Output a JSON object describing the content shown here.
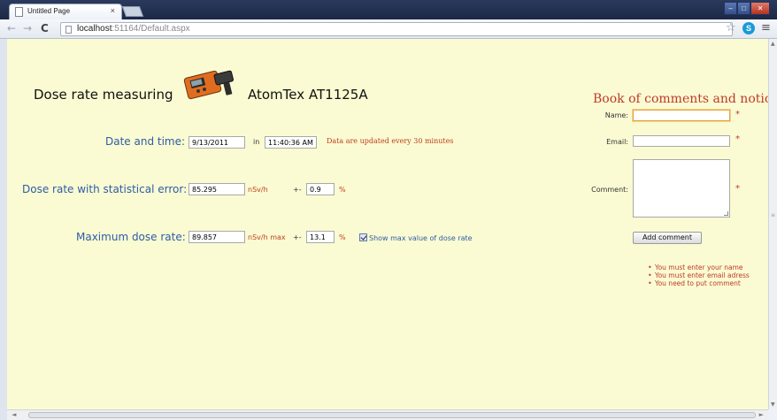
{
  "browser": {
    "tab_title": "Untitled Page",
    "tab_close": "×",
    "url_host": "localhost",
    "url_rest": ":51164/Default.aspx"
  },
  "page": {
    "title_left": "Dose rate measuring",
    "title_right": "AtomTex AT1125A",
    "datetime": {
      "label": "Date and time:",
      "date": "9/13/2011",
      "in_text": "in",
      "time": "11:40:36 AM",
      "note": "Data are updated every 30 minutes"
    },
    "dose_rate": {
      "label": "Dose rate with statistical error:",
      "value": "85.295",
      "unit": "nSv/h",
      "pm": "+-",
      "error": "0.9",
      "error_unit": "%"
    },
    "max_dose": {
      "label": "Maximum dose rate:",
      "value": "89.857",
      "unit": "nSv/h max",
      "pm": "+-",
      "error": "13.1",
      "error_unit": "%",
      "checkbox_label": "Show max value of dose rate",
      "checkbox_checked": true
    }
  },
  "comments": {
    "title": "Book of comments and notices",
    "name_label": "Name:",
    "email_label": "Email:",
    "comment_label": "Comment:",
    "required_mark": "*",
    "submit_label": "Add comment",
    "errors": [
      "You must enter your name",
      "You must enter email adress",
      "You need to put comment"
    ]
  }
}
